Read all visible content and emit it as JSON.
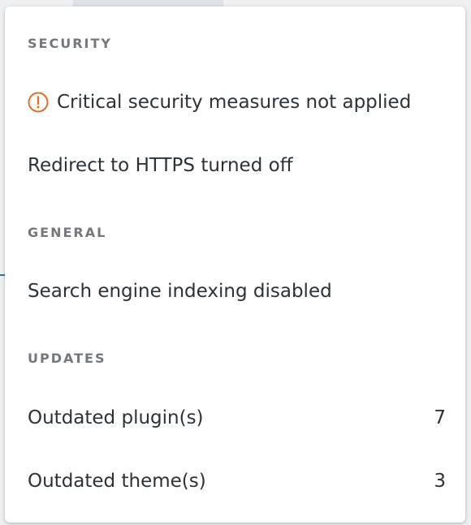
{
  "sections": {
    "security": {
      "heading": "SECURITY",
      "critical_label": "Critical security measures not applied",
      "critical_icon": "alert-circle-icon",
      "https_label": "Redirect to HTTPS turned off"
    },
    "general": {
      "heading": "GENERAL",
      "indexing_label": "Search engine indexing disabled"
    },
    "updates": {
      "heading": "UPDATES",
      "plugins_label": "Outdated plugin(s)",
      "plugins_count": "7",
      "themes_label": "Outdated theme(s)",
      "themes_count": "3"
    }
  },
  "colors": {
    "warning": "#e26f2a",
    "heading": "#74787d",
    "text": "#2c3338"
  }
}
